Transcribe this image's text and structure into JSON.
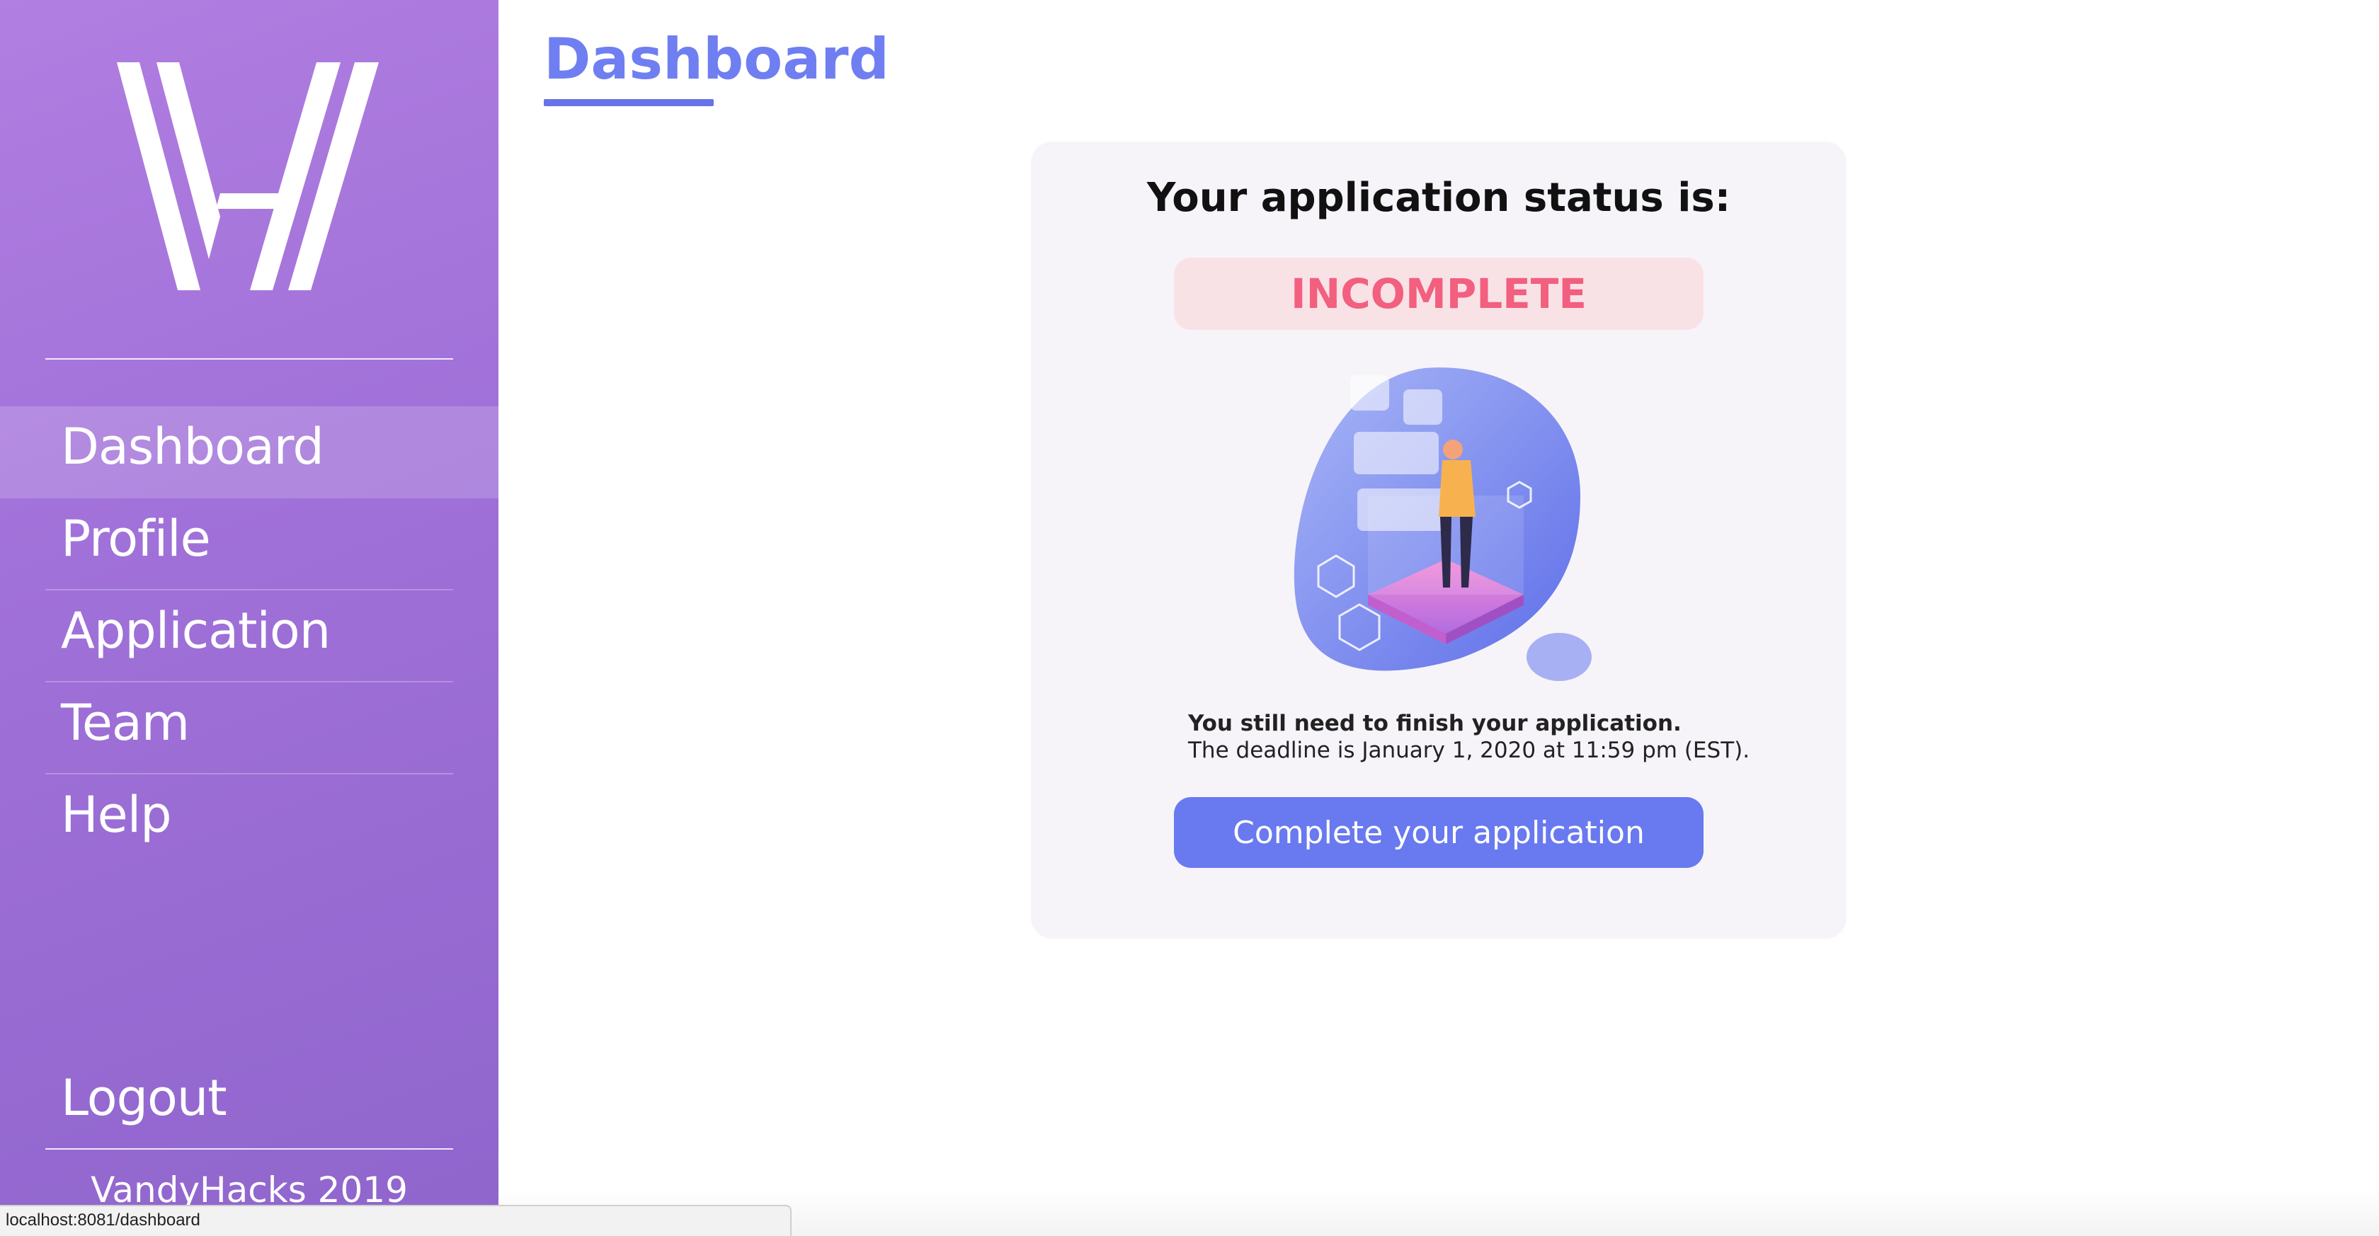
{
  "sidebar": {
    "logo_icon": "vandyhacks-logo-icon",
    "nav": [
      {
        "label": "Dashboard",
        "active": true
      },
      {
        "label": "Profile",
        "active": false
      },
      {
        "label": "Application",
        "active": false
      },
      {
        "label": "Team",
        "active": false
      },
      {
        "label": "Help",
        "active": false
      }
    ],
    "logout_label": "Logout",
    "footer": "VandyHacks 2019",
    "gradient_colors": [
      "#b17ee1",
      "#8f65cc"
    ]
  },
  "main": {
    "title": "Dashboard",
    "accent_color": "#6f7ef0",
    "card": {
      "heading": "Your application status is:",
      "status": "INCOMPLETE",
      "status_color": "#f25f7f",
      "illustration_icon": "person-with-floating-cards-illustration",
      "message_bold": "You still need to finish your application.",
      "message": "The deadline is January 1, 2020 at 11:59 pm (EST).",
      "button_label": "Complete your application",
      "button_color": "#6979f0"
    }
  },
  "browser": {
    "status_url": "localhost:8081/dashboard"
  }
}
